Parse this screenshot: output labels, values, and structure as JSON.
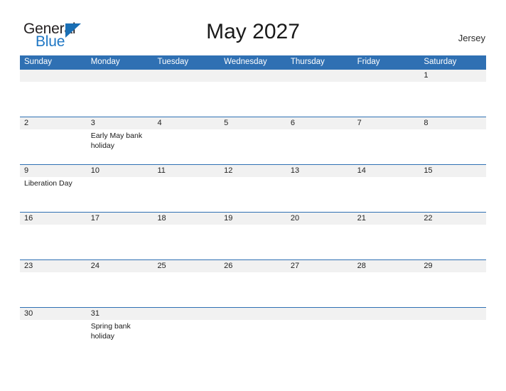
{
  "brand": {
    "word_one": "General",
    "word_two": "Blue",
    "triangle_color": "#1a6fb5",
    "blue_text_color": "#1f77c4"
  },
  "header": {
    "title": "May 2027",
    "region": "Jersey"
  },
  "theme": {
    "header_blue": "#2f70b3",
    "number_band_gray": "#f1f1f1",
    "divider_blue": "#2f70b3",
    "text_color": "#1a1a1a"
  },
  "calendar": {
    "month": "May",
    "year": "2027",
    "weekday_headers": [
      "Sunday",
      "Monday",
      "Tuesday",
      "Wednesday",
      "Thursday",
      "Friday",
      "Saturday"
    ],
    "weeks": [
      {
        "days": [
          {
            "number": "",
            "event": ""
          },
          {
            "number": "",
            "event": ""
          },
          {
            "number": "",
            "event": ""
          },
          {
            "number": "",
            "event": ""
          },
          {
            "number": "",
            "event": ""
          },
          {
            "number": "",
            "event": ""
          },
          {
            "number": "1",
            "event": ""
          }
        ]
      },
      {
        "days": [
          {
            "number": "2",
            "event": ""
          },
          {
            "number": "3",
            "event": "Early May bank holiday"
          },
          {
            "number": "4",
            "event": ""
          },
          {
            "number": "5",
            "event": ""
          },
          {
            "number": "6",
            "event": ""
          },
          {
            "number": "7",
            "event": ""
          },
          {
            "number": "8",
            "event": ""
          }
        ]
      },
      {
        "days": [
          {
            "number": "9",
            "event": "Liberation Day"
          },
          {
            "number": "10",
            "event": ""
          },
          {
            "number": "11",
            "event": ""
          },
          {
            "number": "12",
            "event": ""
          },
          {
            "number": "13",
            "event": ""
          },
          {
            "number": "14",
            "event": ""
          },
          {
            "number": "15",
            "event": ""
          }
        ]
      },
      {
        "days": [
          {
            "number": "16",
            "event": ""
          },
          {
            "number": "17",
            "event": ""
          },
          {
            "number": "18",
            "event": ""
          },
          {
            "number": "19",
            "event": ""
          },
          {
            "number": "20",
            "event": ""
          },
          {
            "number": "21",
            "event": ""
          },
          {
            "number": "22",
            "event": ""
          }
        ]
      },
      {
        "days": [
          {
            "number": "23",
            "event": ""
          },
          {
            "number": "24",
            "event": ""
          },
          {
            "number": "25",
            "event": ""
          },
          {
            "number": "26",
            "event": ""
          },
          {
            "number": "27",
            "event": ""
          },
          {
            "number": "28",
            "event": ""
          },
          {
            "number": "29",
            "event": ""
          }
        ]
      },
      {
        "days": [
          {
            "number": "30",
            "event": ""
          },
          {
            "number": "31",
            "event": "Spring bank holiday"
          },
          {
            "number": "",
            "event": ""
          },
          {
            "number": "",
            "event": ""
          },
          {
            "number": "",
            "event": ""
          },
          {
            "number": "",
            "event": ""
          },
          {
            "number": "",
            "event": ""
          }
        ]
      }
    ]
  }
}
